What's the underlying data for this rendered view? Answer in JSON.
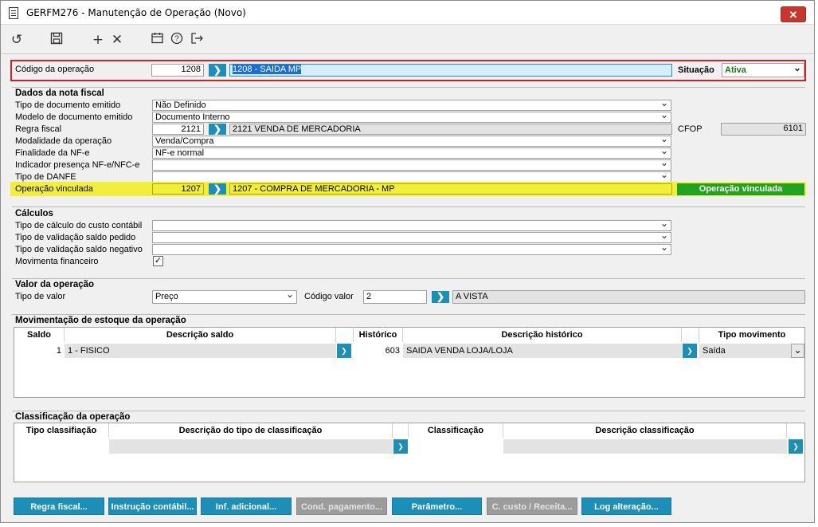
{
  "window": {
    "title": "GERFM276 - Manutenção de Operação (Novo)",
    "close_label": "✕"
  },
  "toolbar": {
    "icons": [
      "undo-icon",
      "save-icon",
      "add-icon",
      "delete-icon",
      "calendar-icon",
      "help-icon",
      "exit-icon"
    ]
  },
  "header": {
    "codigo_label": "Código da operação",
    "codigo_value": "1208",
    "codigo_desc": "1208 - SAIDA MP",
    "situacao_label": "Situação",
    "situacao_value": "Ativa"
  },
  "nota_fiscal": {
    "section_title": "Dados da nota fiscal",
    "tipo_documento_label": "Tipo de documento emitido",
    "tipo_documento_value": "Não Definido",
    "modelo_documento_label": "Modelo de documento emitido",
    "modelo_documento_value": "Documento Interno",
    "regra_fiscal_label": "Regra fiscal",
    "regra_fiscal_code": "2121",
    "regra_fiscal_desc": "2121 VENDA DE MERCADORIA",
    "cfop_label": "CFOP",
    "cfop_value": "6101",
    "modalidade_label": "Modalidade da operação",
    "modalidade_value": "Venda/Compra",
    "finalidade_label": "Finalidade da NF-e",
    "finalidade_value": "NF-e normal",
    "indicador_label": "Indicador presença NF-e/NFC-e",
    "indicador_value": "",
    "danfe_label": "Tipo de DANFE",
    "danfe_value": "",
    "vinculada_label": "Operação vinculada",
    "vinculada_code": "1207",
    "vinculada_desc": "1207 - COMPRA DE MERCADORIA - MP",
    "vinculada_badge": "Operação vinculada"
  },
  "calculos": {
    "section_title": "Cálculos",
    "custo_label": "Tipo de cálculo do custo contábil",
    "custo_value": "",
    "saldo_pedido_label": "Tipo de validação saldo pedido",
    "saldo_pedido_value": "",
    "saldo_negativo_label": "Tipo de validação saldo negativo",
    "saldo_negativo_value": "",
    "financeiro_label": "Movimenta financeiro",
    "financeiro_checked": "✓"
  },
  "valor": {
    "section_title": "Valor da operação",
    "tipo_label": "Tipo de valor",
    "tipo_value": "Preço",
    "codigo_label": "Código valor",
    "codigo_value": "2",
    "codigo_desc": "A VISTA"
  },
  "estoque": {
    "section_title": "Movimentação de estoque da operação",
    "columns": [
      "Saldo",
      "Descrição saldo",
      "Histórico",
      "Descrição histórico",
      "Tipo movimento"
    ],
    "rows": [
      {
        "saldo": "1",
        "descricao_saldo": "1 - FISICO",
        "historico": "603",
        "descricao_historico": "SAIDA VENDA LOJA/LOJA",
        "tipo_movimento": "Saída"
      }
    ]
  },
  "classificacao": {
    "section_title": "Classificação da operação",
    "columns": [
      "Tipo classifiação",
      "Descrição do tipo de classificação",
      "Classificação",
      "Descrição classificação"
    ]
  },
  "buttons": {
    "regra_fiscal": "Regra fiscal...",
    "instrucao_contabil": "Instrução contábil...",
    "inf_adicional": "Inf. adicional...",
    "cond_pagamento": "Cond. pagamento...",
    "parametro": "Parâmetro...",
    "custo_receita": "C. custo / Receita...",
    "log_alteracao": "Log alteração..."
  },
  "colors": {
    "accent": "#1c8fb8",
    "highlight": "#f2ef3c",
    "badge_green": "#21a321",
    "status_green": "#1a7a1a",
    "frame_red": "#d32020"
  }
}
